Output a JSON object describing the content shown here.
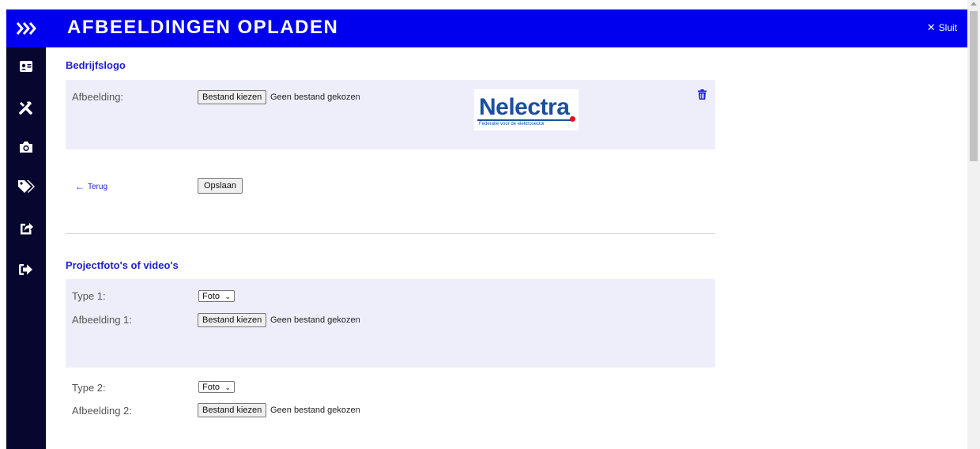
{
  "header": {
    "title": "AFBEELDINGEN OPLADEN",
    "close_label": "Sluit",
    "brand_color": "#0000ee"
  },
  "sidebar": {
    "items": [
      {
        "icon": "id-card-icon"
      },
      {
        "icon": "tools-icon"
      },
      {
        "icon": "camera-icon"
      },
      {
        "icon": "tags-icon"
      },
      {
        "icon": "share-icon"
      },
      {
        "icon": "sign-out-icon"
      }
    ]
  },
  "logo_section": {
    "title": "Bedrijfslogo",
    "label": "Afbeelding:",
    "file_button": "Bestand kiezen",
    "file_status": "Geen bestand gekozen",
    "logo_text": "Nelectra",
    "logo_subtext": "Federatie voor de elektrosector",
    "back_label": "Terug",
    "save_label": "Opslaan"
  },
  "project_section": {
    "title": "Projectfoto's of video's",
    "items": [
      {
        "type_label": "Type 1:",
        "type_value": "Foto",
        "image_label": "Afbeelding 1:",
        "file_button": "Bestand kiezen",
        "file_status": "Geen bestand gekozen"
      },
      {
        "type_label": "Type 2:",
        "type_value": "Foto",
        "image_label": "Afbeelding 2:",
        "file_button": "Bestand kiezen",
        "file_status": "Geen bestand gekozen"
      }
    ]
  }
}
